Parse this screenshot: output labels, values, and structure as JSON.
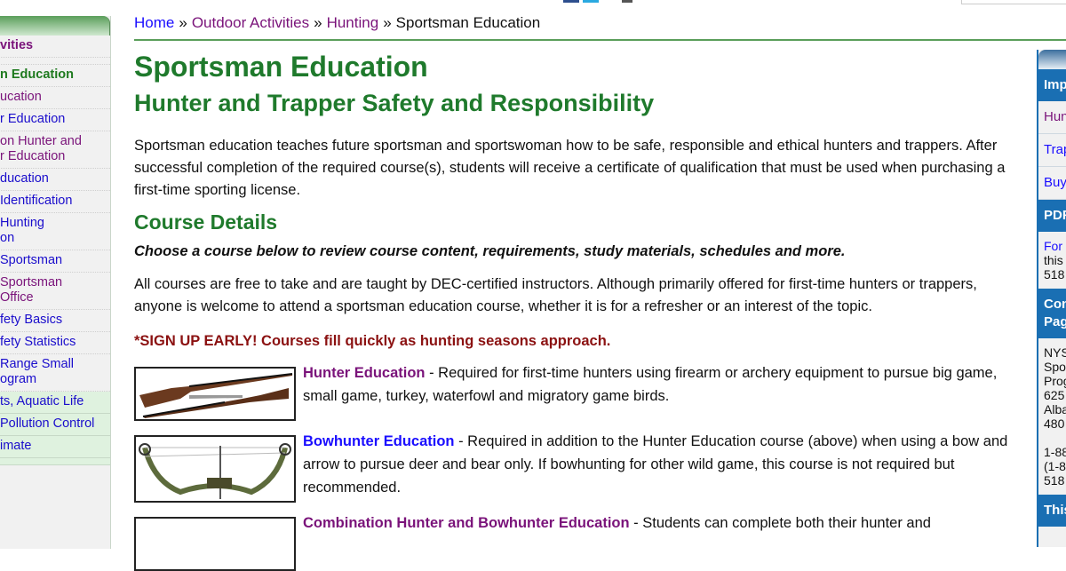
{
  "breadcrumb": {
    "items": [
      {
        "label": "Home",
        "state": "link"
      },
      {
        "label": "Outdoor Activities",
        "state": "visited"
      },
      {
        "label": "Hunting",
        "state": "visited"
      },
      {
        "label": "Sportsman Education",
        "state": "current"
      }
    ],
    "separator": "»"
  },
  "left_sidebar": {
    "items": [
      {
        "label": "Outdoor Activities",
        "visible": "vities",
        "type": "section"
      },
      {
        "label": "",
        "visible": "",
        "type": "link"
      },
      {
        "label": "Sportsman Education",
        "visible": "n Education",
        "type": "current"
      },
      {
        "label": "Hunter Education",
        "visible": "ucation",
        "type": "visited"
      },
      {
        "label": "Bowhunter Education",
        "visible": "r Education",
        "type": "link"
      },
      {
        "label": "Combination Hunter and Bowhunter Education",
        "visible": "on Hunter and\nr Education",
        "type": "visited"
      },
      {
        "label": "Trapper Education",
        "visible": "ducation",
        "type": "link"
      },
      {
        "label": "Waterfowl Identification",
        "visible": " Identification\n ",
        "type": "link"
      },
      {
        "label": "Hunting Education",
        "visible": " Hunting\non",
        "type": "link"
      },
      {
        "label": "Sportsman",
        "visible": "Sportsman\n ",
        "type": "link"
      },
      {
        "label": "Sportsman Office",
        "visible": "Sportsman\n Office",
        "type": "visited"
      },
      {
        "label": "Safety Basics",
        "visible": "fety Basics",
        "type": "link"
      },
      {
        "label": "Safety Statistics",
        "visible": "fety Statistics",
        "type": "link"
      },
      {
        "label": "Range Small Program",
        "visible": "Range Small\nogram",
        "type": "link"
      },
      {
        "label": "Plants, Aquatic Life",
        "visible": "ts, Aquatic Life",
        "type": "green"
      },
      {
        "label": "Pollution Control",
        "visible": " Pollution Control",
        "type": "green"
      },
      {
        "label": "Climate",
        "visible": "imate",
        "type": "green"
      },
      {
        "label": "",
        "visible": "",
        "type": "green"
      }
    ]
  },
  "main": {
    "title": "Sportsman Education",
    "subtitle": "Hunter and Trapper Safety and Responsibility",
    "intro": "Sportsman education teaches future sportsman and sportswoman how to be safe, responsible and ethical hunters and trappers. After successful completion of the required course(s), students will receive a certificate of qualification that must be used when purchasing a first-time sporting license.",
    "course_details_heading": "Course Details",
    "choose_text": "Choose a course below to review course content, requirements, study materials, schedules and more.",
    "all_courses_text": "All courses are free to take and are taught by DEC-certified instructors. Although primarily offered for first-time hunters or trappers, anyone is welcome to attend a sportsman education course, whether it is for a refresher or an interest of the topic.",
    "signup_text": "*SIGN UP EARLY! Courses fill quickly as hunting seasons approach.",
    "courses": [
      {
        "title": "Hunter Education",
        "description": " - Required for first-time hunters using firearm or archery equipment to pursue big game, small game, turkey, waterfowl and migratory game birds.",
        "image": "rifles"
      },
      {
        "title": "Bowhunter Education",
        "description": " - Required in addition to the Hunter Education course (above) when using a bow and arrow to pursue deer and bear only. If bowhunting for other wild game, this course is not required but recommended.",
        "image": "compound-bow"
      },
      {
        "title": "Combination Hunter and Bowhunter Education",
        "description": " - Students can complete both their hunter and",
        "image": "rifle"
      }
    ]
  },
  "right_sidebar": {
    "important_heading": "Imp",
    "links": [
      {
        "label": "Hun",
        "state": "visited"
      },
      {
        "label": "Trap",
        "state": "link"
      },
      {
        "label": "Buy",
        "state": "link"
      }
    ],
    "pdf_heading": "PDF",
    "pdf_text_link": "For",
    "pdf_text_lines": [
      "this",
      "518"
    ],
    "contact_heading": "Con\nPag",
    "contact_lines": [
      "NYS",
      "Spo",
      "Prog",
      "625",
      "Alba",
      "480",
      "",
      "1-88",
      "(1-8",
      "518"
    ],
    "this_heading": "This"
  },
  "colors": {
    "heading_green": "#1f7a2c",
    "link_blue": "#1a0dff",
    "visited_purple": "#7a137a",
    "alert_red": "#8b1111",
    "right_blue": "#1a6fb3"
  }
}
